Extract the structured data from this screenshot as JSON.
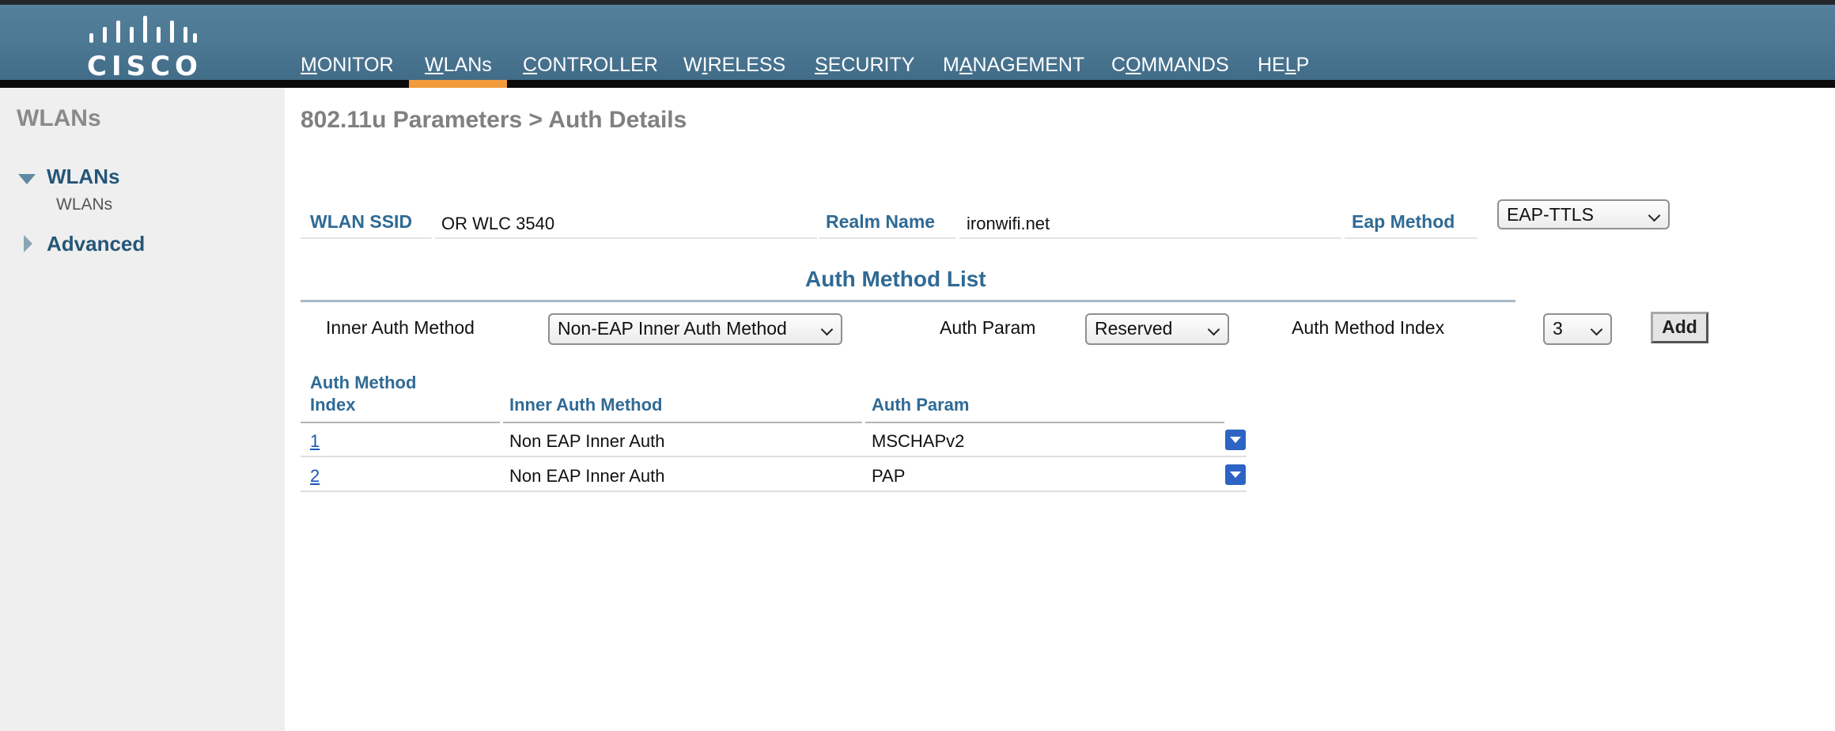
{
  "brand": {
    "logo_text": "CISCO"
  },
  "nav": [
    {
      "key": "monitor",
      "pre": "",
      "u": "M",
      "post": "ONITOR"
    },
    {
      "key": "wlans",
      "pre": "",
      "u": "W",
      "post": "LANs"
    },
    {
      "key": "controller",
      "pre": "",
      "u": "C",
      "post": "ONTROLLER"
    },
    {
      "key": "wireless",
      "pre": "W",
      "u": "I",
      "post": "RELESS"
    },
    {
      "key": "security",
      "pre": "",
      "u": "S",
      "post": "ECURITY"
    },
    {
      "key": "management",
      "pre": "M",
      "u": "A",
      "post": "NAGEMENT"
    },
    {
      "key": "commands",
      "pre": "C",
      "u": "O",
      "post": "MMANDS"
    },
    {
      "key": "help",
      "pre": "HE",
      "u": "L",
      "post": "P"
    }
  ],
  "sidebar": {
    "title": "WLANs",
    "wlans_label": "WLANs",
    "wlans_sub": "WLANs",
    "advanced_label": "Advanced"
  },
  "page": {
    "title": "802.11u Parameters > Auth Details"
  },
  "form": {
    "wlan_ssid_label": "WLAN SSID",
    "wlan_ssid_value": "OR WLC 3540",
    "realm_name_label": "Realm Name",
    "realm_name_value": "ironwifi.net",
    "eap_method_label": "Eap Method",
    "eap_method_value": "EAP-TTLS"
  },
  "auth_method_list": {
    "title": "Auth Method List",
    "inner_auth_label": "Inner Auth Method",
    "inner_auth_value": "Non-EAP Inner Auth Method",
    "auth_param_label": "Auth Param",
    "auth_param_value": "Reserved",
    "index_label": "Auth Method Index",
    "index_value": "3",
    "add_button": "Add"
  },
  "table": {
    "headers": {
      "index_line1": "Auth Method",
      "index_line2": "Index",
      "inner_auth": "Inner Auth Method",
      "auth_param": "Auth Param"
    },
    "rows": [
      {
        "index": "1",
        "inner_auth": "Non EAP Inner Auth",
        "auth_param": "MSCHAPv2"
      },
      {
        "index": "2",
        "inner_auth": "Non EAP Inner Auth",
        "auth_param": "PAP"
      }
    ]
  },
  "colors": {
    "header_blue": "#4d7894",
    "nav_active": "#f29a3c",
    "label_blue": "#2f6a94",
    "link_blue": "#1a57b8"
  }
}
